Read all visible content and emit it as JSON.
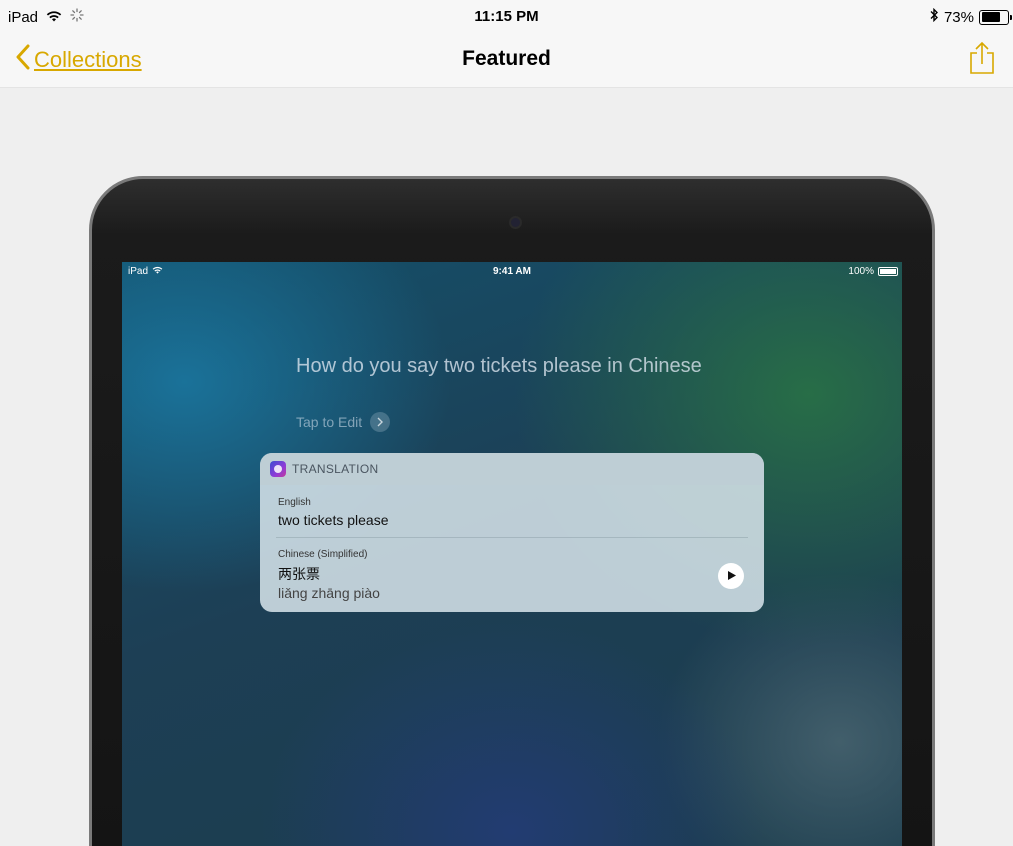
{
  "status_bar": {
    "device": "iPad",
    "time": "11:15 PM",
    "battery_pct": "73%",
    "battery_level": 0.73
  },
  "nav": {
    "back_label": "Collections",
    "title": "Featured",
    "accent_color": "#d8a800"
  },
  "screen": {
    "status": {
      "device": "iPad",
      "time": "9:41 AM",
      "battery": "100%"
    },
    "query": "How do you say two tickets please in Chinese",
    "tap_to_edit": "Tap to Edit",
    "card": {
      "header": "TRANSLATION",
      "source_lang": "English",
      "source_text": "two tickets please",
      "target_lang": "Chinese (Simplified)",
      "target_text": "两张票",
      "pinyin": "liǎng zhāng piào"
    }
  }
}
